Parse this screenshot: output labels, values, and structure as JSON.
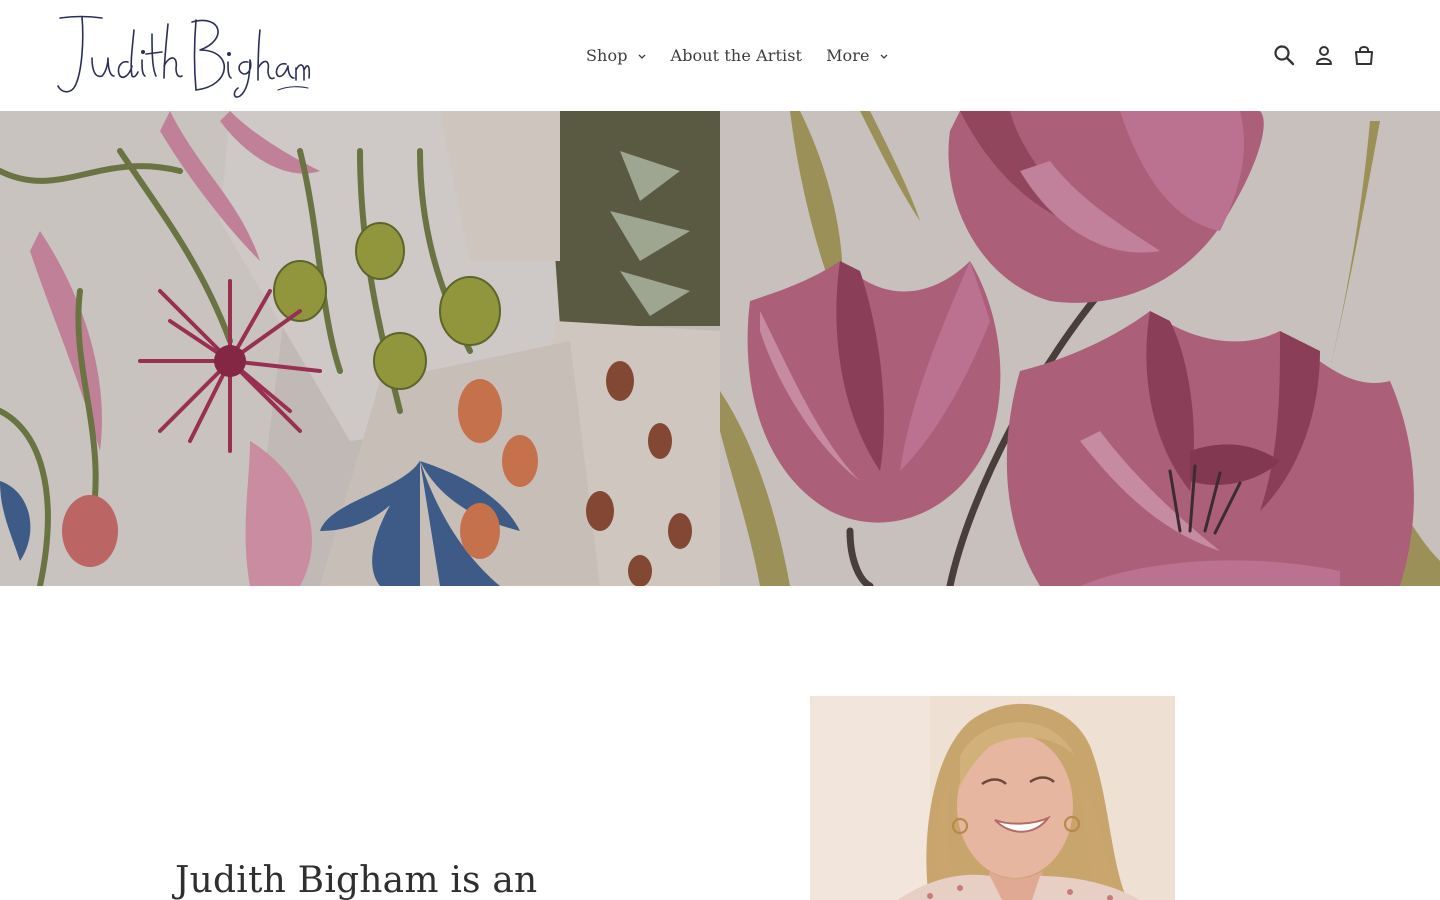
{
  "brand": {
    "logo_text": "Judith Bigham"
  },
  "nav": {
    "items": [
      {
        "label": "Shop",
        "has_dropdown": true,
        "icon": "chevron-down-icon"
      },
      {
        "label": "About the Artist",
        "has_dropdown": false
      },
      {
        "label": "More",
        "has_dropdown": true,
        "icon": "chevron-down-icon"
      }
    ]
  },
  "header_icons": [
    "search-icon",
    "account-icon",
    "cart-icon"
  ],
  "intro": {
    "heading": "Judith Bigham is an"
  },
  "colors": {
    "text": "#3a3a3a",
    "tulip_pink": "#b66b82",
    "tulip_dark": "#8f4a62",
    "leaf_green": "#8f9b3c",
    "ink_blue": "#2a2f5a"
  }
}
